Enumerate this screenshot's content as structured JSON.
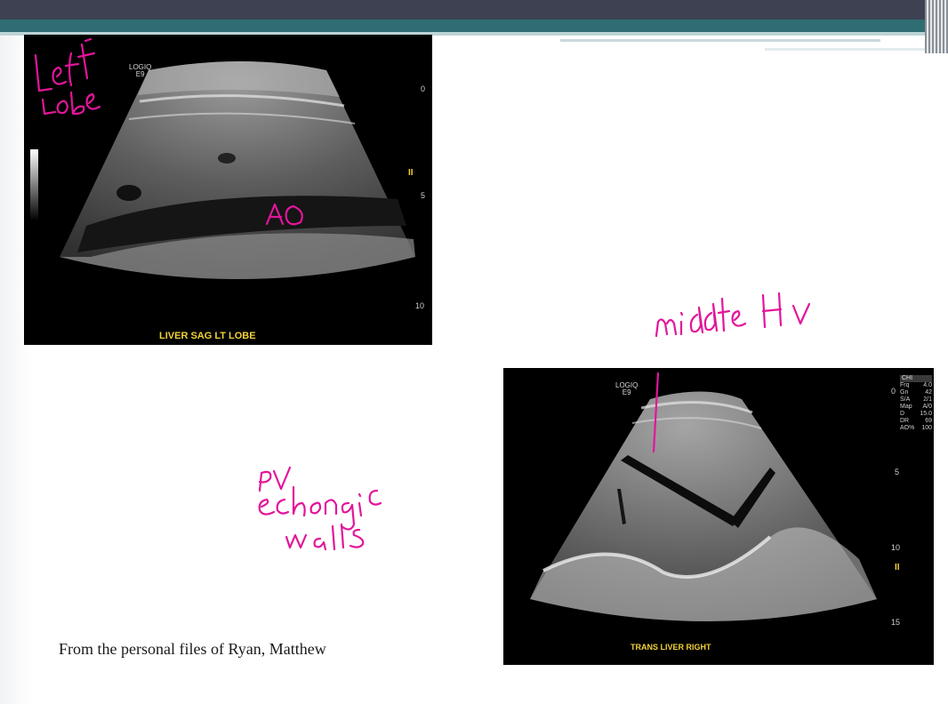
{
  "images": [
    {
      "caption": "LIVER SAG LT LOBE",
      "logo_line1": "LOGIQ",
      "logo_line2": "E9",
      "depth_ticks": [
        "0",
        "5",
        "10"
      ]
    },
    {
      "caption": "TRANS LIVER RIGHT",
      "logo_line1": "LOGIQ",
      "logo_line2": "E9",
      "depth_ticks": [
        "0",
        "5",
        "10",
        "15"
      ],
      "params_header": "CHI",
      "params": [
        {
          "k": "Frq",
          "v": "4.0"
        },
        {
          "k": "Gn",
          "v": "42"
        },
        {
          "k": "S/A",
          "v": "2/1"
        },
        {
          "k": "Map",
          "v": "A/0"
        },
        {
          "k": "D",
          "v": "15.0"
        },
        {
          "k": "DR",
          "v": "69"
        },
        {
          "k": "AO%",
          "v": "100"
        }
      ]
    }
  ],
  "credit": "From the personal files of Ryan, Matthew",
  "annotations": {
    "left_lobe": "Left Lobe",
    "ao": "AO",
    "middle_hv": "middle HV",
    "pv_echogenic_walls": "PV echogenic walls",
    "color": "#e3159a"
  }
}
